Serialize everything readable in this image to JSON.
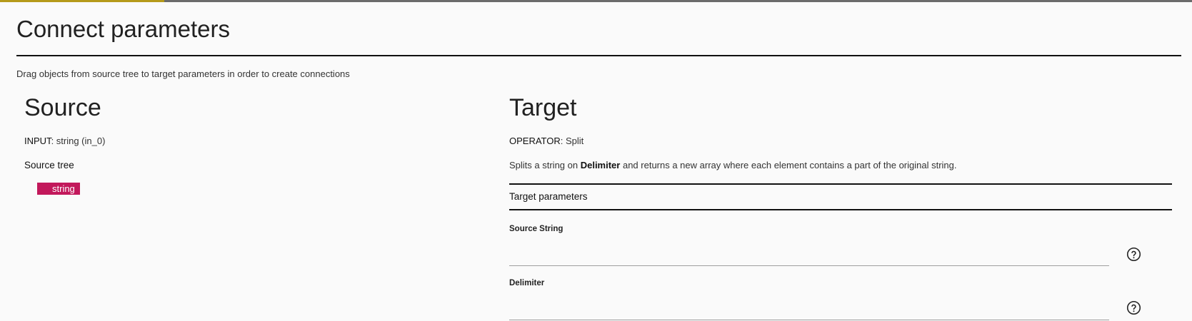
{
  "header": {
    "title": "Connect parameters",
    "instructions": "Drag objects from source tree to target parameters in order to create connections"
  },
  "source": {
    "title": "Source",
    "input_key": "INPUT",
    "input_value": ": string (in_0)",
    "tree_label": "Source tree",
    "tree_items": [
      {
        "label": "string",
        "color": "#c2185b"
      }
    ]
  },
  "target": {
    "title": "Target",
    "operator_key": "OPERATOR",
    "operator_value": ": Split",
    "description": {
      "before": "Splits a string on ",
      "bold": "Delimiter",
      "after": " and returns a new array where each element contains a part of the original string."
    },
    "params_label": "Target parameters",
    "fields": [
      {
        "label": "Source String",
        "value": "",
        "help_icon": "help-circle-icon"
      },
      {
        "label": "Delimiter",
        "value": "",
        "help_icon": "help-circle-icon"
      }
    ]
  },
  "colors": {
    "accent": "#c2185b",
    "top_bar": "#6b6b6b",
    "top_bar_accent": "#b59a1a",
    "background": "#fafafa"
  }
}
